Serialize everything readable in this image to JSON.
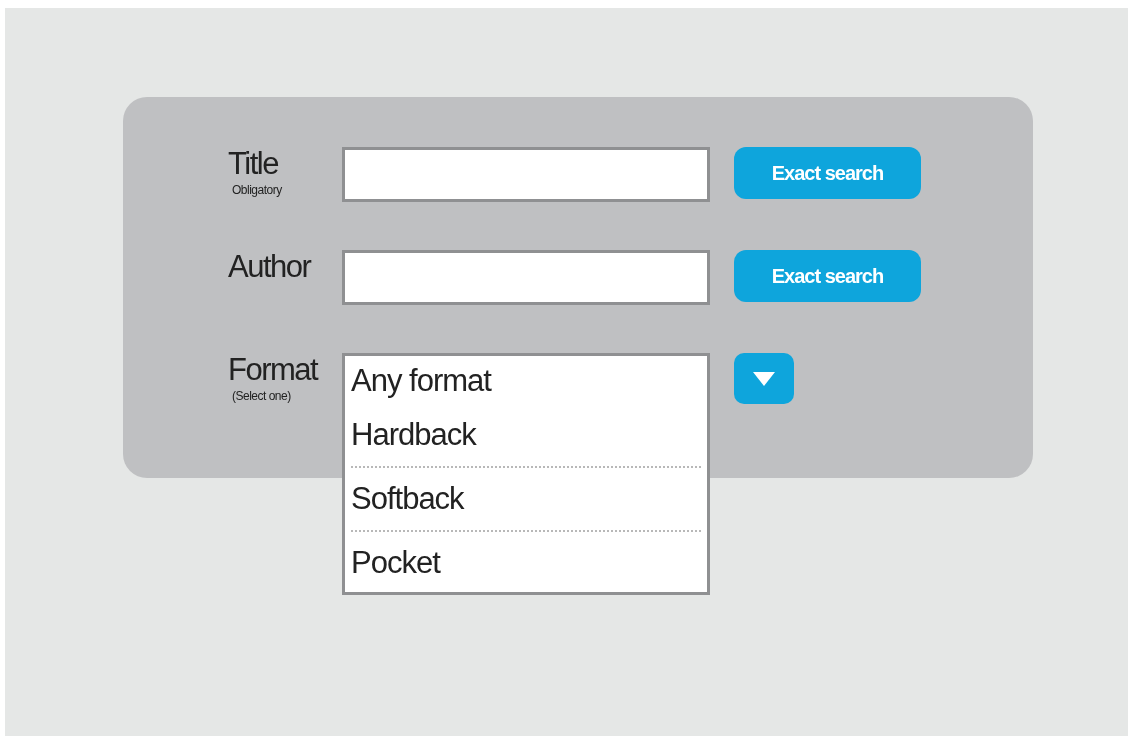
{
  "fields": [
    {
      "kind": "text",
      "label": "Title",
      "note": "Obligatory",
      "button": "Exact search"
    },
    {
      "kind": "text",
      "label": "Author",
      "button": "Exact search"
    },
    {
      "kind": "select",
      "label": "Format",
      "note": "(Select one)",
      "value": "Any format",
      "expanded": true,
      "options": [
        "Hardback",
        "Softback",
        "Pocket"
      ]
    }
  ]
}
